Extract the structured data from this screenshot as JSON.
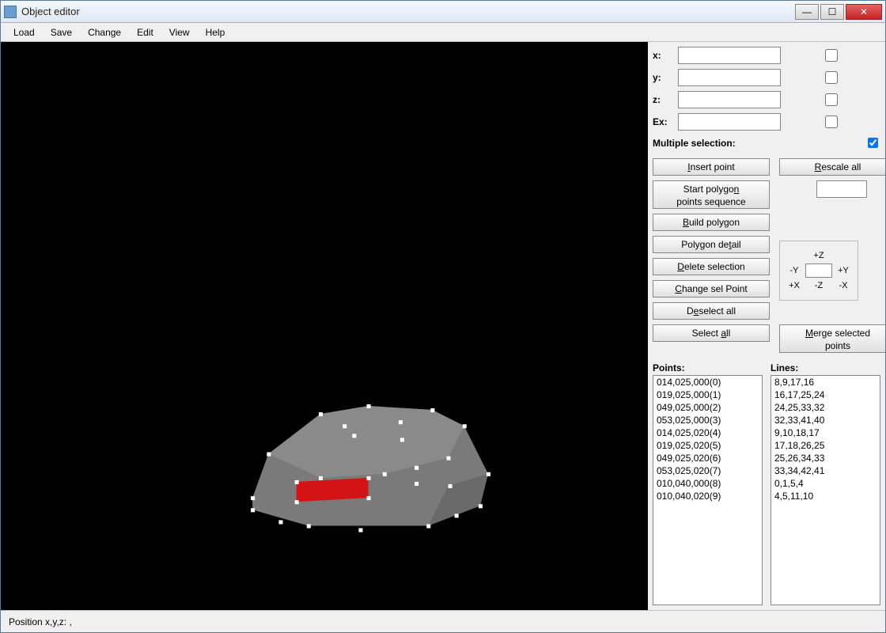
{
  "window": {
    "title": "Object editor"
  },
  "menu": {
    "load": "Load",
    "save": "Save",
    "change": "Change",
    "edit": "Edit",
    "view": "View",
    "help": "Help"
  },
  "fields": {
    "x_label": "x:",
    "y_label": "y:",
    "z_label": "z:",
    "ex_label": "Ex:",
    "x_value": "",
    "y_value": "",
    "z_value": "",
    "ex_value": "",
    "multisel_label": "Multiple selection:"
  },
  "buttons": {
    "insert_point": "Insert point",
    "rescale_all": "Rescale all",
    "start_polygon_1": "Start polygon",
    "start_polygon_2": "points sequence",
    "build_polygon": "Build polygon",
    "polygon_detail": "Polygon detail",
    "delete_selection": "Delete selection",
    "change_sel_point": "Change sel Point",
    "deselect_all": "Deselect all",
    "select_all": "Select all",
    "merge_1": "Merge selected",
    "merge_2": "points"
  },
  "nav": {
    "pz": "+Z",
    "mz": "-Z",
    "py": "+Y",
    "my": "-Y",
    "px": "+X",
    "mx": "-X"
  },
  "lists": {
    "points_hdr": "Points:",
    "lines_hdr": "Lines:",
    "points": [
      "014,025,000(0)",
      "019,025,000(1)",
      "049,025,000(2)",
      "053,025,000(3)",
      "014,025,020(4)",
      "019,025,020(5)",
      "049,025,020(6)",
      "053,025,020(7)",
      "010,040,000(8)",
      "010,040,020(9)"
    ],
    "lines": [
      "8,9,17,16",
      "16,17,25,24",
      "24,25,33,32",
      "32,33,41,40",
      "9,10,18,17",
      "17,18,26,25",
      "25,26,34,33",
      "33,34,42,41",
      "0,1,5,4",
      "4,5,11,10"
    ]
  },
  "status": {
    "label": "Position x,y,z:          ,"
  },
  "chart_data": null
}
